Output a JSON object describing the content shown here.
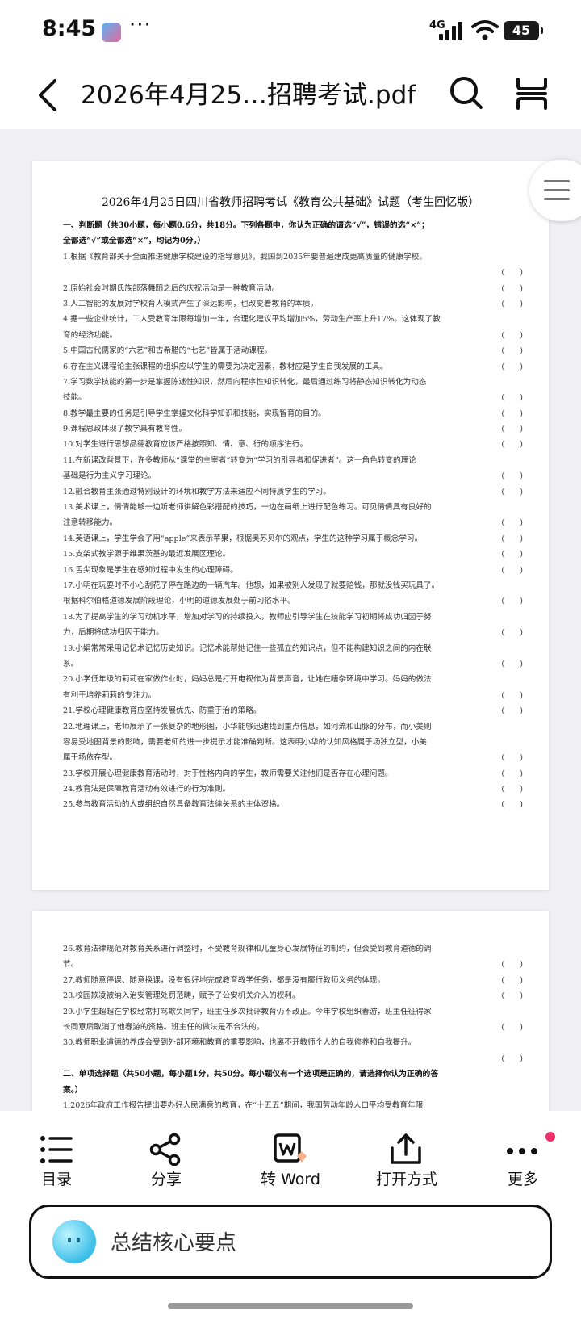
{
  "status": {
    "time": "8:45",
    "dots": "···",
    "network": "4G",
    "battery": "45"
  },
  "header": {
    "title": "2026年4月25…招聘考试.pdf"
  },
  "page1": {
    "title": "2026年4月25日四川省教师招聘考试《教育公共基础》试题（考生回忆版）",
    "lines": [
      {
        "text": "一、判断题（共30小题，每小题0.6分，共18分。下列各题中，你认为正确的请选“√”，错误的选“×”；",
        "paren": "",
        "section": true
      },
      {
        "text": "全都选“√”或全都选“×”，均记为0分。）",
        "paren": "",
        "section": true
      },
      {
        "text": "1.根据《教育部关于全面推进健康学校建设的指导意见》，我国到2035年要普遍建成更高质量的健康学校。",
        "paren": ""
      },
      {
        "text": "",
        "paren": "(　　)"
      },
      {
        "text": "2.原始社会时期氏族部落舞蹈之后的庆祝活动是一种教育活动。",
        "paren": "(　　)"
      },
      {
        "text": "3.人工智能的发展对学校育人模式产生了深远影响，也改变着教育的本质。",
        "paren": "(　　)"
      },
      {
        "text": "4.据一些企业统计，工人受教育年限每增加一年，合理化建议平均增加5%，劳动生产率上升17%。这体现了教",
        "paren": ""
      },
      {
        "text": "育的经济功能。",
        "paren": "(　　)"
      },
      {
        "text": "5.中国古代儒家的“六艺”和古希腊的“七艺”皆属于活动课程。",
        "paren": "(　　)"
      },
      {
        "text": "6.存在主义课程论主张课程的组织应以学生的需要为决定因素，教材应是学生自我发展的工具。",
        "paren": "(　　)"
      },
      {
        "text": "7.学习数学技能的第一步是掌握陈述性知识，然后向程序性知识转化，最后通过练习将静态知识转化为动态",
        "paren": ""
      },
      {
        "text": "技能。",
        "paren": "(　　)"
      },
      {
        "text": "8.教学最主要的任务是引导学生掌握文化科学知识和技能，实现智育的目的。",
        "paren": "(　　)"
      },
      {
        "text": "9.课程思政体现了教学具有教育性。",
        "paren": "(　　)"
      },
      {
        "text": "10.对学生进行思想品德教育应该严格按照知、情、意、行的顺序进行。",
        "paren": "(　　)"
      },
      {
        "text": "11.在新课改背景下，许多教师从“课堂的主宰者”转变为“学习的引导者和促进者”。这一角色转变的理论",
        "paren": ""
      },
      {
        "text": "基础是行为主义学习理论。",
        "paren": "(　　)"
      },
      {
        "text": "12.融合教育主张通过特别设计的环境和教学方法来适应不同特质学生的学习。",
        "paren": "(　　)"
      },
      {
        "text": "13.美术课上，倩倩能够一边听老师讲解色彩搭配的技巧，一边在画纸上进行配色练习。可见倩倩具有良好的",
        "paren": ""
      },
      {
        "text": "注意转移能力。",
        "paren": "(　　)"
      },
      {
        "text": "14.英语课上，学生学会了用“apple”来表示苹果，根据奥苏贝尔的观点，学生的这种学习属于概念学习。",
        "paren": "(　　)"
      },
      {
        "text": "15.支架式教学源于维果茨基的最近发展区理论。",
        "paren": "(　　)"
      },
      {
        "text": "16.舌尖现象是学生在感知过程中发生的心理障碍。",
        "paren": "(　　)"
      },
      {
        "text": "17.小明在玩耍时不小心刮花了停在路边的一辆汽车。他想，如果被别人发现了就要赔钱，那就没钱买玩具了。",
        "paren": ""
      },
      {
        "text": "根据科尔伯格道德发展阶段理论，小明的道德发展处于前习俗水平。",
        "paren": "(　　)"
      },
      {
        "text": "18.为了提高学生的学习动机水平，增加对学习的持续投入，教师应引导学生在技能学习初期将成功归因于努",
        "paren": ""
      },
      {
        "text": "力，后期将成功归因于能力。",
        "paren": "(　　)"
      },
      {
        "text": "19.小娟常常采用记忆术记忆历史知识。记忆术能帮她记住一些孤立的知识点，但不能构建知识之间的内在联",
        "paren": ""
      },
      {
        "text": "系。",
        "paren": "(　　)"
      },
      {
        "text": "20.小学低年级的莉莉在家做作业时，妈妈总是打开电视作为背景声音，让她在嘈杂环境中学习。妈妈的做法",
        "paren": ""
      },
      {
        "text": "有利于培养莉莉的专注力。",
        "paren": "(　　)"
      },
      {
        "text": "21.学校心理健康教育应坚持发展优先、防重于治的策略。",
        "paren": "(　　)"
      },
      {
        "text": "22.地理课上，老师展示了一张复杂的地形图，小华能够迅速找到重点信息，如河流和山脉的分布，而小美则",
        "paren": ""
      },
      {
        "text": "容易受地图背景的影响，需要老师的进一步提示才能准确判断。这表明小华的认知风格属于场独立型，小美",
        "paren": ""
      },
      {
        "text": "属于场依存型。",
        "paren": "(　　)"
      },
      {
        "text": "23.学校开展心理健康教育活动时，对于性格内向的学生，教师需要关注他们是否存在心理问题。",
        "paren": "(　　)"
      },
      {
        "text": "24.教育法是保障教育活动有效进行的行为准则。",
        "paren": "(　　)"
      },
      {
        "text": "25.参与教育活动的人或组织自然具备教育法律关系的主体资格。",
        "paren": "(　　)"
      }
    ]
  },
  "page2": {
    "lines": [
      {
        "text": "26.教育法律规范对教育关系进行调整时，不受教育规律和儿童身心发展特征的制约，但会受到教育道德的调",
        "paren": ""
      },
      {
        "text": "节。",
        "paren": "(　　)"
      },
      {
        "text": "27.教师随意停课、随意换课，没有很好地完成教育教学任务，都是没有履行教师义务的体现。",
        "paren": "(　　)"
      },
      {
        "text": "28.校园欺凌被纳入治安管理处罚范畴，赋予了公安机关介入的权利。",
        "paren": "(　　)"
      },
      {
        "text": "29.小学生超超在学校经常打骂欺负同学，班主任多次批评教育仍不改正。今年学校组织春游，班主任征得家",
        "paren": ""
      },
      {
        "text": "长同意后取消了他春游的资格。班主任的做法是不合法的。",
        "paren": "(　　)"
      },
      {
        "text": "30.教师职业道德的养成会受到外部环境和教育的重要影响，也离不开教师个人的自我修养和自我提升。",
        "paren": ""
      },
      {
        "text": "",
        "paren": "(　　)"
      },
      {
        "text": "二、单项选择题（共50小题，每小题1分，共50分。每小题仅有一个选项是正确的，请选择你认为正确的答",
        "paren": "",
        "section": true
      },
      {
        "text": "案。）",
        "paren": "",
        "section": true
      },
      {
        "text": "1.2026年政府工作报告提出要办好人民满意的教育，在“十五五”期间，我国劳动年龄人口平均受教育年限",
        "paren": ""
      }
    ]
  },
  "toolbar": {
    "items": [
      {
        "label": "目录",
        "icon": "list-icon"
      },
      {
        "label": "分享",
        "icon": "share-icon"
      },
      {
        "label": "转 Word",
        "icon": "word-icon"
      },
      {
        "label": "打开方式",
        "icon": "open-with-icon"
      },
      {
        "label": "更多",
        "icon": "more-icon"
      }
    ]
  },
  "ai_bar": {
    "text": "总结核心要点"
  },
  "colors": {
    "accent_dot": "#f0306a",
    "page_bg": "#f0f0f2"
  }
}
